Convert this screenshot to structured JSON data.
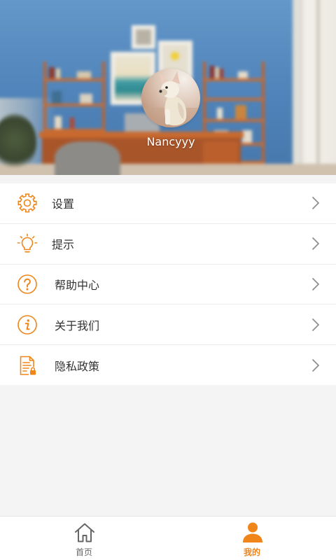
{
  "profile": {
    "username": "Nancyyy"
  },
  "menu": {
    "items": [
      {
        "label": "设置",
        "icon": "gear-icon"
      },
      {
        "label": "提示",
        "icon": "lightbulb-icon"
      },
      {
        "label": "帮助中心",
        "icon": "question-circle-icon"
      },
      {
        "label": "关于我们",
        "icon": "info-circle-icon"
      },
      {
        "label": "隐私政策",
        "icon": "document-lock-icon"
      }
    ],
    "row_action_icon": "chevron-right-icon"
  },
  "tabbar": {
    "tabs": [
      {
        "label": "首页",
        "icon": "home-icon",
        "active": false
      },
      {
        "label": "我的",
        "icon": "user-icon",
        "active": true
      }
    ]
  },
  "colors": {
    "accent": "#f08519",
    "inactive": "#666666",
    "page_background": "#f4f4f4",
    "text": "#333333"
  }
}
